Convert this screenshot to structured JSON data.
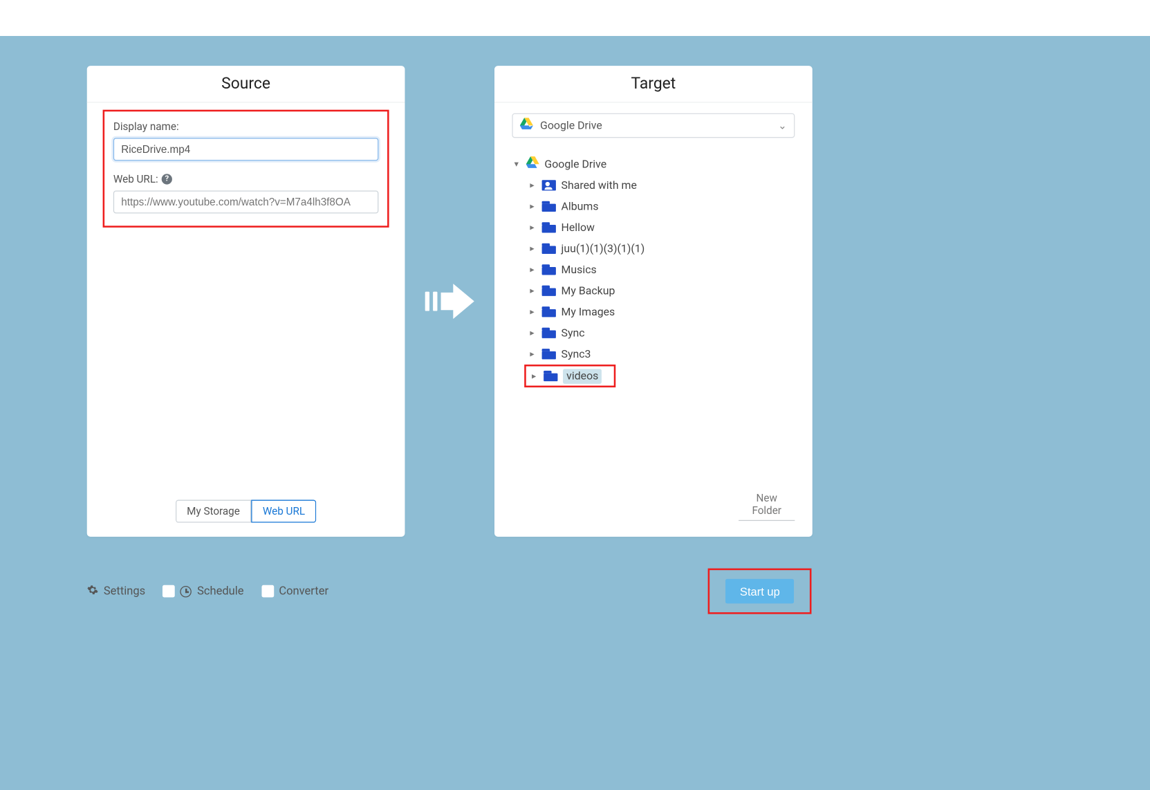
{
  "source": {
    "title": "Source",
    "display_name_label": "Display name:",
    "display_name_value": "RiceDrive.mp4",
    "web_url_label": "Web URL:",
    "web_url_placeholder": "https://www.youtube.com/watch?v=M7a4lh3f8OA",
    "tabs": {
      "my_storage": "My Storage",
      "web_url": "Web URL"
    }
  },
  "target": {
    "title": "Target",
    "selected_drive": "Google Drive",
    "root": "Google Drive",
    "folders": [
      {
        "label": "Shared with me",
        "icon": "shared"
      },
      {
        "label": "Albums",
        "icon": "folder"
      },
      {
        "label": "Hellow",
        "icon": "folder"
      },
      {
        "label": "juu(1)(1)(3)(1)(1)",
        "icon": "folder"
      },
      {
        "label": "Musics",
        "icon": "folder"
      },
      {
        "label": "My Backup",
        "icon": "folder"
      },
      {
        "label": "My Images",
        "icon": "folder"
      },
      {
        "label": "Sync",
        "icon": "folder"
      },
      {
        "label": "Sync3",
        "icon": "folder"
      }
    ],
    "selected_folder": "videos",
    "new_folder": "New Folder"
  },
  "bottom": {
    "settings": "Settings",
    "schedule": "Schedule",
    "converter": "Converter",
    "start": "Start up"
  }
}
